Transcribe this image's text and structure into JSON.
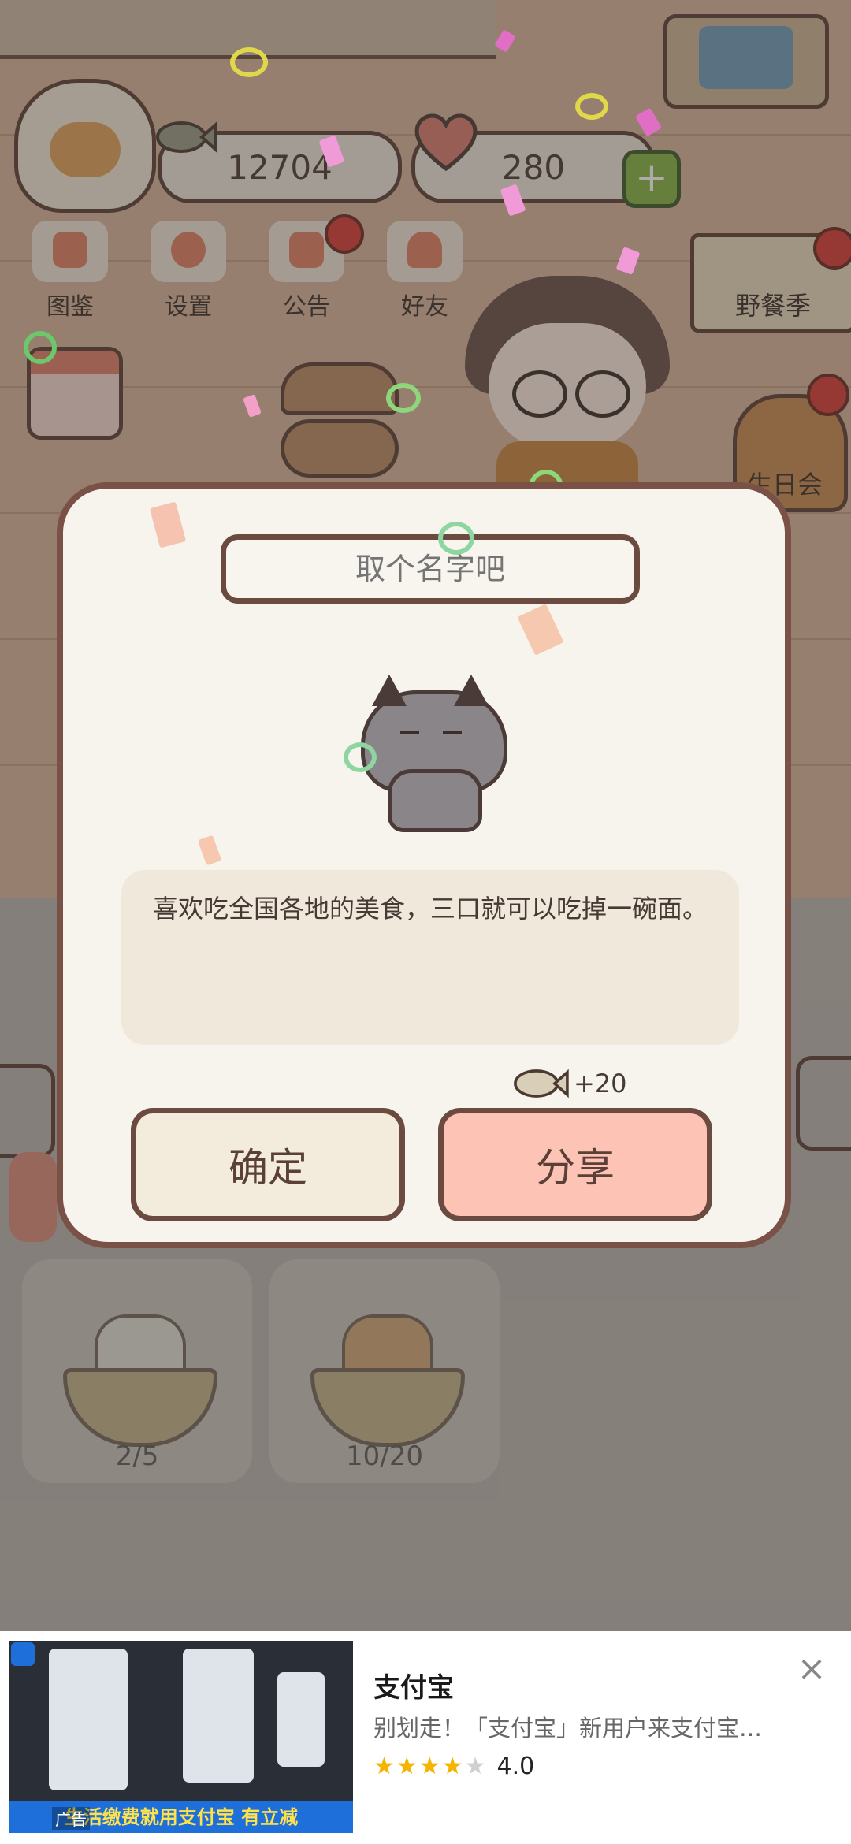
{
  "hud": {
    "fish_count": "12704",
    "heart_count": "280",
    "add_symbol": "+"
  },
  "menu": [
    {
      "label": "图鉴",
      "icon": "cat-book-icon"
    },
    {
      "label": "设置",
      "icon": "gear-icon"
    },
    {
      "label": "公告",
      "icon": "gift-icon"
    },
    {
      "label": "好友",
      "icon": "friends-icon"
    }
  ],
  "events": {
    "picnic": "野餐季",
    "birthday": "生日会"
  },
  "dialog": {
    "name_placeholder": "取个名字吧",
    "description": "喜欢吃全国各地的美食，三口就可以吃掉一碗面。",
    "reward": "+20",
    "confirm_label": "确定",
    "share_label": "分享"
  },
  "cards": [
    {
      "count": "2/5"
    },
    {
      "count": "10/20"
    }
  ],
  "ad": {
    "title": "支付宝",
    "description": "别划走！「支付宝」新用户来支付宝…",
    "rating": "4.0",
    "rating_value": 4,
    "banner_text": "生活缴费就用支付宝 有立减",
    "tag": "广告",
    "close_symbol": "×"
  },
  "colors": {
    "share_button": "#fdc3b4",
    "confirm_button": "#f3ecdc",
    "dialog_border": "#7a5146",
    "ad_brand": "#1e6fd9"
  }
}
